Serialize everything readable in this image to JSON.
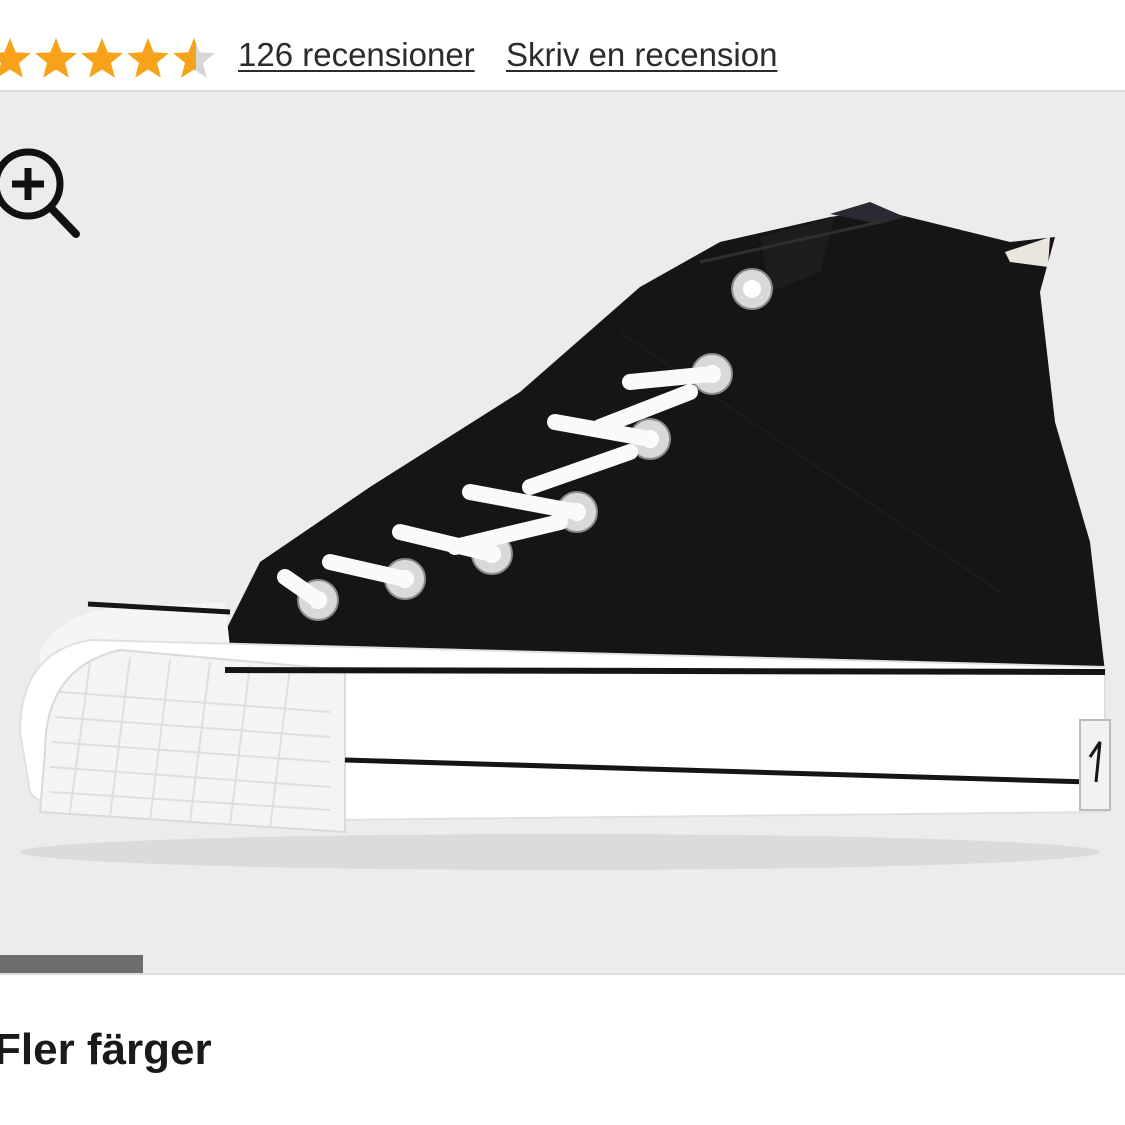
{
  "rating": {
    "stars_filled": 4.5,
    "stars_total": 5,
    "star_color": "#f7a21b",
    "reviews_count_label": "126 recensioner",
    "write_review_label": "Skriv en recension"
  },
  "gallery": {
    "zoom_icon": "zoom-in-icon",
    "image_subject": "black high-top platform canvas sneaker",
    "background_color": "#ececec",
    "progress": 0.127,
    "progress_color": "#6d6d6d"
  },
  "more_colors": {
    "label": "Fler färger"
  }
}
